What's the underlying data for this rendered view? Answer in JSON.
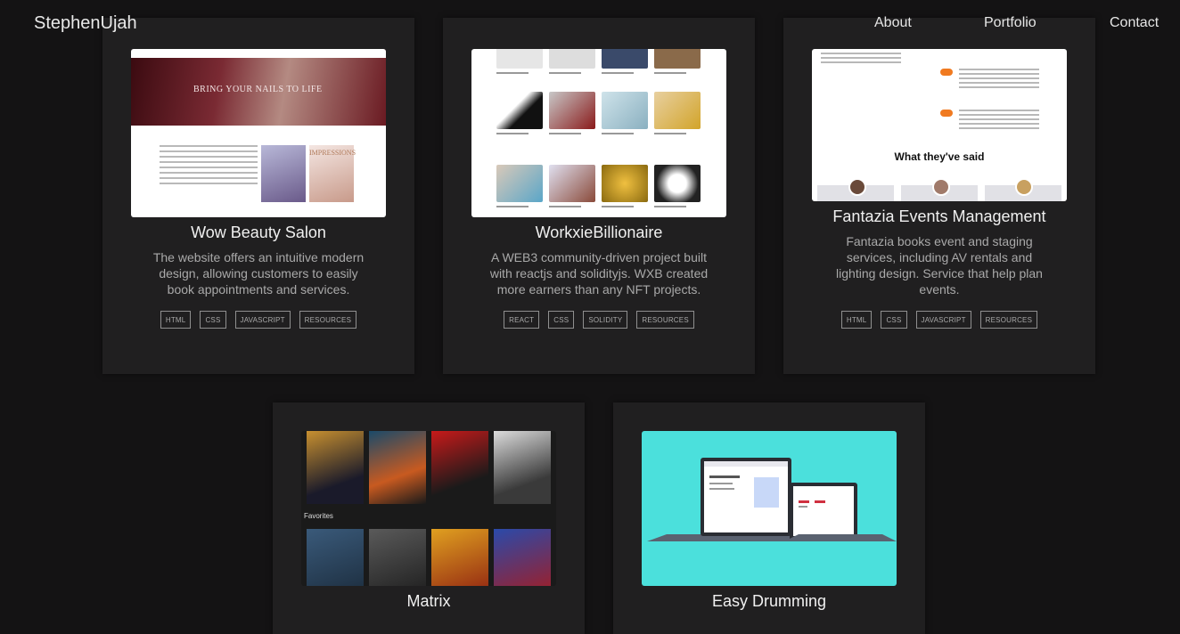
{
  "nav": {
    "brand": "StephenUjah",
    "links": [
      "About",
      "Portfolio",
      "Contact"
    ]
  },
  "projects": [
    {
      "title": "Wow Beauty Salon",
      "description": "The website offers an intuitive modern design, allowing customers to easily book appointments and services.",
      "tags": [
        "HTML",
        "CSS",
        "JAVASCRIPT",
        "RESOURCES"
      ],
      "preview": {
        "headline": "BRING YOUR NAILS TO LIFE",
        "promo": "IMPRESSIONS"
      }
    },
    {
      "title": "WorkxieBillionaire",
      "description": "A WEB3 community-driven project built with reactjs and solidityjs. WXB created more earners than any NFT projects.",
      "tags": [
        "REACT",
        "CSS",
        "SOLIDITY",
        "RESOURCES"
      ]
    },
    {
      "title": "Fantazia Events Management",
      "description": "Fantazia books event and staging services, including AV rentals and lighting design. Service that help plan events.",
      "tags": [
        "HTML",
        "CSS",
        "JAVASCRIPT",
        "RESOURCES"
      ],
      "preview": {
        "section_heading": "What they've said"
      }
    },
    {
      "title": "Matrix",
      "preview": {
        "section_label": "Favorites"
      }
    },
    {
      "title": "Easy Drumming"
    }
  ],
  "colors": {
    "background": "#141314",
    "card": "#201f20",
    "accent_orange": "#f07a20",
    "drum_bg": "#4be0dc"
  }
}
